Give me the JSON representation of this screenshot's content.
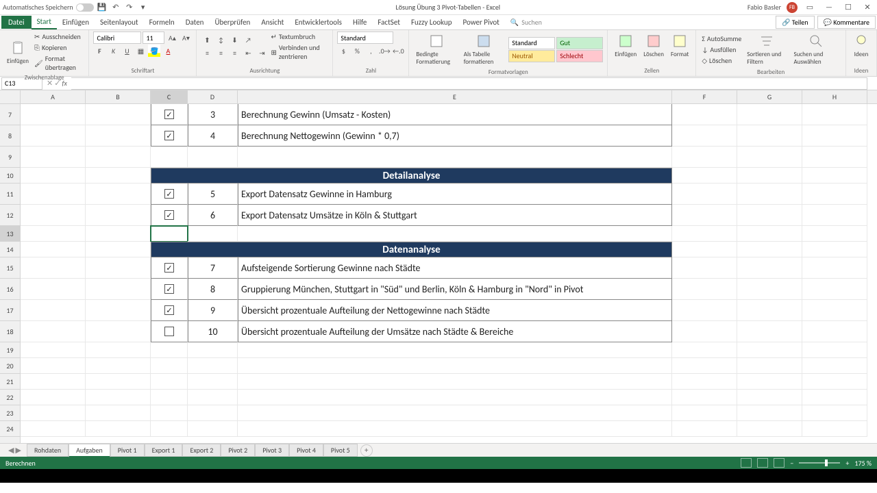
{
  "titlebar": {
    "autosave": "Automatisches Speichern",
    "doc_title": "Lösung Übung 3 Pivot-Tabellen - Excel",
    "user": "Fabio Basler",
    "user_initials": "FB"
  },
  "tabs": {
    "file": "Datei",
    "items": [
      "Start",
      "Einfügen",
      "Seitenlayout",
      "Formeln",
      "Daten",
      "Überprüfen",
      "Ansicht",
      "Entwicklertools",
      "Hilfe",
      "FactSet",
      "Fuzzy Lookup",
      "Power Pivot"
    ],
    "search": "Suchen",
    "share": "Teilen",
    "comments": "Kommentare"
  },
  "ribbon": {
    "clipboard": {
      "label": "Zwischenablage",
      "paste": "Einfügen",
      "cut": "Ausschneiden",
      "copy": "Kopieren",
      "format": "Format übertragen"
    },
    "font": {
      "label": "Schriftart",
      "name": "Calibri",
      "size": "11"
    },
    "align": {
      "label": "Ausrichtung",
      "wrap": "Textumbruch",
      "merge": "Verbinden und zentrieren"
    },
    "number": {
      "label": "Zahl",
      "format": "Standard"
    },
    "styles": {
      "label": "Formatvorlagen",
      "conditional": "Bedingte Formatierung",
      "table": "Als Tabelle formatieren",
      "standard": "Standard",
      "gut": "Gut",
      "neutral": "Neutral",
      "schlecht": "Schlecht"
    },
    "cells": {
      "label": "Zellen",
      "insert": "Einfügen",
      "delete": "Löschen",
      "format": "Format"
    },
    "editing": {
      "label": "Bearbeiten",
      "autosum": "AutoSumme",
      "fill": "Ausfüllen",
      "clear": "Löschen",
      "sort": "Sortieren und Filtern",
      "find": "Suchen und Auswählen"
    },
    "ideas": {
      "label": "Ideen",
      "btn": "Ideen"
    }
  },
  "namebox": "C13",
  "columns": [
    "A",
    "B",
    "C",
    "D",
    "E",
    "F",
    "G",
    "H"
  ],
  "rows": [
    "7",
    "8",
    "9",
    "10",
    "11",
    "12",
    "13",
    "14",
    "15",
    "16",
    "17",
    "18",
    "19",
    "20",
    "21",
    "22",
    "23",
    "24"
  ],
  "data": {
    "r7": {
      "d": "3",
      "e": "Berechnung Gewinn (Umsatz - Kosten)",
      "check": true
    },
    "r8": {
      "d": "4",
      "e": "Berechnung Nettogewinn (Gewinn * 0,7)",
      "check": true
    },
    "h10": "Detailanalyse",
    "r11": {
      "d": "5",
      "e": "Export Datensatz Gewinne in Hamburg",
      "check": true
    },
    "r12": {
      "d": "6",
      "e": "Export Datensatz Umsätze in Köln & Stuttgart",
      "check": true
    },
    "h14": "Datenanalyse",
    "r15": {
      "d": "7",
      "e": "Aufsteigende Sortierung Gewinne nach Städte",
      "check": true
    },
    "r16": {
      "d": "8",
      "e": "Gruppierung München, Stuttgart in \"Süd\" und Berlin, Köln & Hamburg in \"Nord\" in Pivot",
      "check": true
    },
    "r17": {
      "d": "9",
      "e": "Übersicht prozentuale Aufteilung der Nettogewinne nach Städte",
      "check": true
    },
    "r18": {
      "d": "10",
      "e": "Übersicht prozentuale Aufteilung der Umsätze nach Städte & Bereiche",
      "check": false
    }
  },
  "sheets": [
    "Rohdaten",
    "Aufgaben",
    "Pivot 1",
    "Export 1",
    "Export 2",
    "Pivot 2",
    "Pivot 3",
    "Pivot 4",
    "Pivot 5"
  ],
  "active_sheet": 1,
  "status": {
    "calc": "Berechnen",
    "zoom": "175 %"
  }
}
